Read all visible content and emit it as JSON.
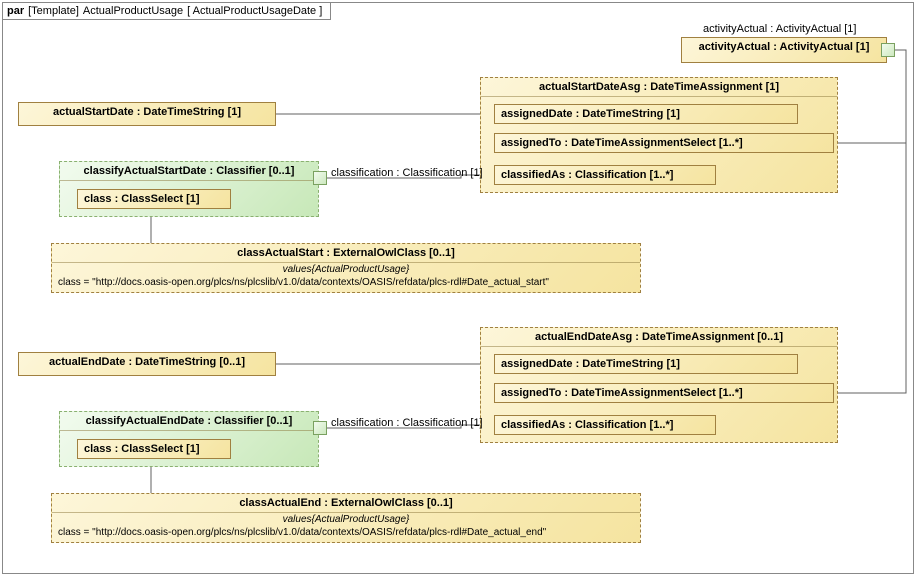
{
  "frame": {
    "keyword": "par",
    "context": "[Template]",
    "name": "ActualProductUsage",
    "param": "[ ActualProductUsageDate ]"
  },
  "labels": {
    "activityActualTop": "activityActual : ActivityActual [1]",
    "classification1": "classification : Classification [1]",
    "classification2": "classification : Classification [1]"
  },
  "activityActual": {
    "title": "activityActual : ActivityActual [1]"
  },
  "actualStartDate": {
    "title": "actualStartDate : DateTimeString [1]"
  },
  "actualStartDateAsg": {
    "title": "actualStartDateAsg : DateTimeAssignment [1]",
    "assignedDate": "assignedDate : DateTimeString [1]",
    "assignedTo": "assignedTo : DateTimeAssignmentSelect [1..*]",
    "classifiedAs": "classifiedAs : Classification [1..*]"
  },
  "classifyActualStartDate": {
    "title": "classifyActualStartDate : Classifier [0..1]",
    "class": "class : ClassSelect [1]"
  },
  "classActualStart": {
    "title": "classActualStart : ExternalOwlClass [0..1]",
    "valuesCaption": "values{ActualProductUsage}",
    "classValue": "class = \"http://docs.oasis-open.org/plcs/ns/plcslib/v1.0/data/contexts/OASIS/refdata/plcs-rdl#Date_actual_start\""
  },
  "actualEndDate": {
    "title": "actualEndDate : DateTimeString [0..1]"
  },
  "actualEndDateAsg": {
    "title": "actualEndDateAsg : DateTimeAssignment [0..1]",
    "assignedDate": "assignedDate : DateTimeString [1]",
    "assignedTo": "assignedTo : DateTimeAssignmentSelect [1..*]",
    "classifiedAs": "classifiedAs : Classification [1..*]"
  },
  "classifyActualEndDate": {
    "title": "classifyActualEndDate : Classifier [0..1]",
    "class": "class : ClassSelect [1]"
  },
  "classActualEnd": {
    "title": "classActualEnd : ExternalOwlClass [0..1]",
    "valuesCaption": "values{ActualProductUsage}",
    "classValue": "class = \"http://docs.oasis-open.org/plcs/ns/plcslib/v1.0/data/contexts/OASIS/refdata/plcs-rdl#Date_actual_end\""
  }
}
